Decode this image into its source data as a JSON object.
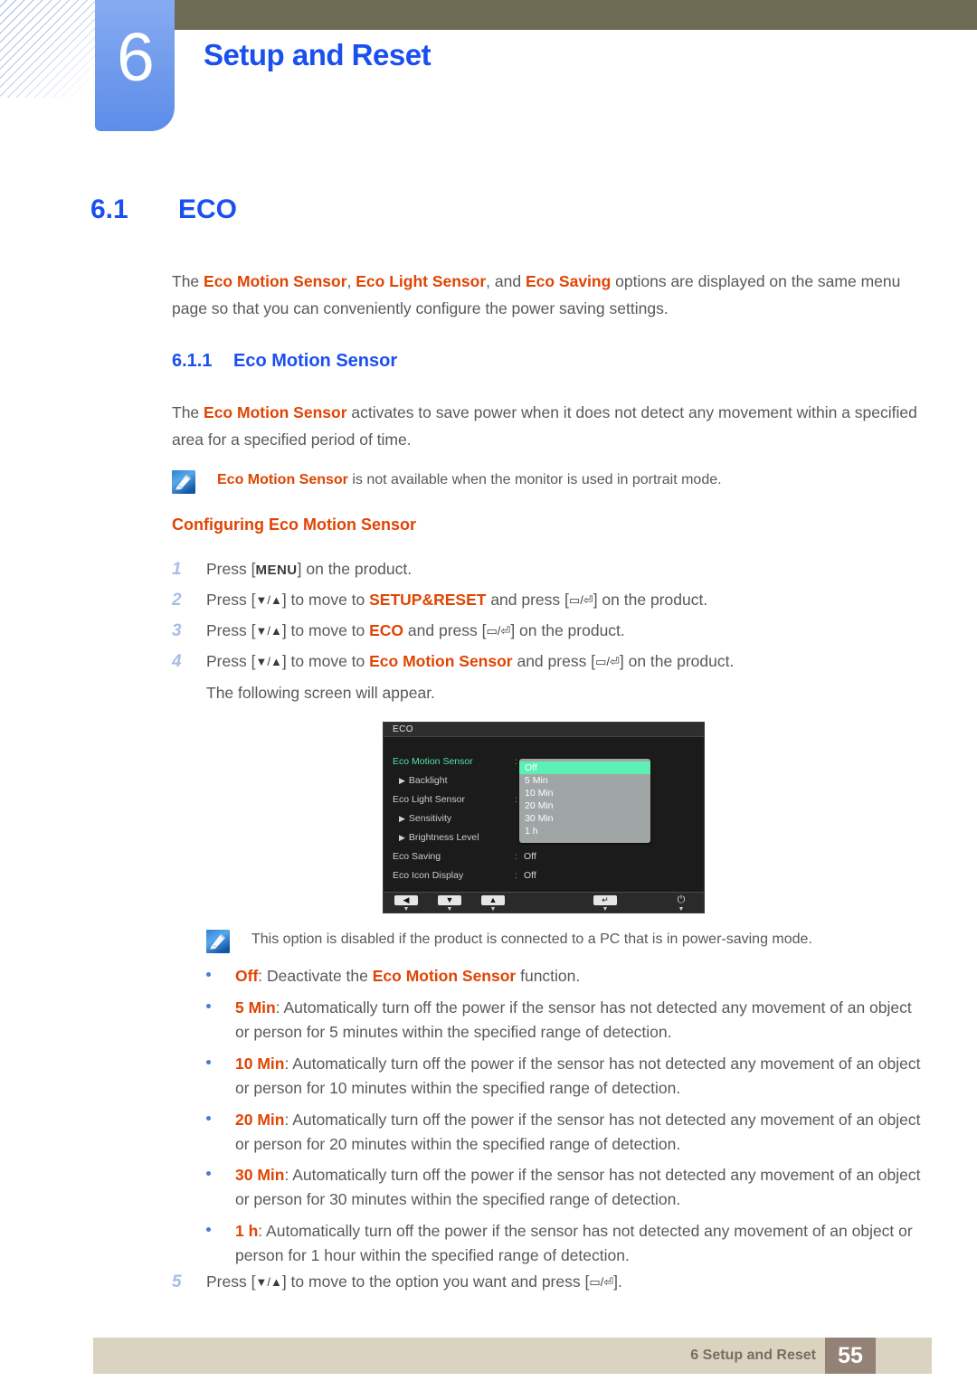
{
  "header": {
    "chapter_number": "6",
    "chapter_title": "Setup and Reset"
  },
  "section": {
    "number": "6.1",
    "title": "ECO",
    "intro": {
      "p1_a": "The ",
      "p1_k1": "Eco Motion Sensor",
      "p1_b": ", ",
      "p1_k2": "Eco Light Sensor",
      "p1_c": ", and ",
      "p1_k3": "Eco Saving",
      "p1_d": " options are displayed on the same menu page so that you can conveniently configure the power saving settings."
    }
  },
  "subsection": {
    "number": "6.1.1",
    "title": "Eco Motion Sensor",
    "paragraph": {
      "a": "The ",
      "k": "Eco Motion Sensor",
      "b": " activates to save power when it does not detect any movement within a specified area for a specified period of time."
    },
    "note1": {
      "icon": "note-pencil-icon",
      "k": "Eco Motion Sensor",
      "text": " is not available when the monitor is used in portrait mode."
    },
    "configuring_heading": "Configuring Eco Motion Sensor"
  },
  "steps": [
    {
      "num": "1",
      "parts": [
        {
          "t": "text",
          "v": "Press ["
        },
        {
          "t": "key",
          "v": "MENU"
        },
        {
          "t": "text",
          "v": "] on the product."
        }
      ]
    },
    {
      "num": "2",
      "parts": [
        {
          "t": "text",
          "v": "Press ["
        },
        {
          "t": "glyph",
          "v": "▼/▲"
        },
        {
          "t": "text",
          "v": "] to move to "
        },
        {
          "t": "kw",
          "v": "SETUP&RESET"
        },
        {
          "t": "text",
          "v": " and press ["
        },
        {
          "t": "glyph",
          "v": "▭/⏎"
        },
        {
          "t": "text",
          "v": "] on the product."
        }
      ]
    },
    {
      "num": "3",
      "parts": [
        {
          "t": "text",
          "v": "Press ["
        },
        {
          "t": "glyph",
          "v": "▼/▲"
        },
        {
          "t": "text",
          "v": "] to move to "
        },
        {
          "t": "kw",
          "v": "ECO"
        },
        {
          "t": "text",
          "v": " and press ["
        },
        {
          "t": "glyph",
          "v": "▭/⏎"
        },
        {
          "t": "text",
          "v": "] on the product."
        }
      ]
    },
    {
      "num": "4",
      "parts": [
        {
          "t": "text",
          "v": "Press ["
        },
        {
          "t": "glyph",
          "v": "▼/▲"
        },
        {
          "t": "text",
          "v": "] to move to "
        },
        {
          "t": "kw",
          "v": "Eco Motion Sensor"
        },
        {
          "t": "text",
          "v": " and press ["
        },
        {
          "t": "glyph",
          "v": "▭/⏎"
        },
        {
          "t": "text",
          "v": "] on the product."
        }
      ],
      "followup": "The following screen will appear."
    },
    {
      "num": "5",
      "parts": [
        {
          "t": "text",
          "v": "Press ["
        },
        {
          "t": "glyph",
          "v": "▼/▲"
        },
        {
          "t": "text",
          "v": "] to move to the option you want and press ["
        },
        {
          "t": "glyph",
          "v": "▭/⏎"
        },
        {
          "t": "text",
          "v": "]."
        }
      ]
    }
  ],
  "osd": {
    "title": "ECO",
    "rows": [
      {
        "label": "Eco Motion Sensor",
        "colon": ":",
        "value": "",
        "selected": true,
        "sub": false
      },
      {
        "label": "Backlight",
        "colon": "",
        "value": "",
        "selected": false,
        "sub": true
      },
      {
        "label": "Eco Light Sensor",
        "colon": ":",
        "value": "",
        "selected": false,
        "sub": false
      },
      {
        "label": "Sensitivity",
        "colon": ":",
        "value": "",
        "selected": false,
        "sub": true
      },
      {
        "label": "Brightness Level",
        "colon": "",
        "value": "",
        "selected": false,
        "sub": true
      },
      {
        "label": "Eco Saving",
        "colon": ":",
        "value": "Off",
        "selected": false,
        "sub": false
      },
      {
        "label": "Eco Icon Display",
        "colon": ":",
        "value": "Off",
        "selected": false,
        "sub": false
      }
    ],
    "dropdown": {
      "options": [
        "Off",
        "5 Min",
        "10 Min",
        "20 Min",
        "30 Min",
        "1 h"
      ],
      "selected": "Off"
    },
    "buttons": [
      {
        "name": "left-arrow",
        "glyph": "◀"
      },
      {
        "name": "down-arrow",
        "glyph": "▼"
      },
      {
        "name": "up-arrow",
        "glyph": "▲"
      },
      {
        "name": "enter",
        "glyph": "↵"
      },
      {
        "name": "power",
        "glyph": "⏻"
      }
    ],
    "colors": {
      "highlight": "#5df0b4",
      "selected_label": "#4ee2a3",
      "background": "#1b1b1b",
      "dropdown_bg": "#9fa6a5"
    }
  },
  "note2": {
    "icon": "note-pencil-icon",
    "text": "This option is disabled if the product is connected to a PC that is in power-saving mode."
  },
  "bullets": [
    {
      "term": "Off",
      "body_a": ": Deactivate the ",
      "body_k": "Eco Motion Sensor",
      "body_b": " function."
    },
    {
      "term": "5 Min",
      "body_a": ": Automatically turn off the power if the sensor has not detected any movement of an object or person for 5 minutes within the specified range of detection.",
      "body_k": "",
      "body_b": ""
    },
    {
      "term": "10 Min",
      "body_a": ": Automatically turn off the power if the sensor has not detected any movement of an object or person for 10 minutes within the specified range of detection.",
      "body_k": "",
      "body_b": ""
    },
    {
      "term": "20 Min",
      "body_a": ": Automatically turn off the power if the sensor has not detected any movement of an object or person for 20 minutes within the specified range of detection.",
      "body_k": "",
      "body_b": ""
    },
    {
      "term": "30 Min",
      "body_a": ": Automatically turn off the power if the sensor has not detected any movement of an object or person for 30 minutes within the specified range of detection.",
      "body_k": "",
      "body_b": ""
    },
    {
      "term": "1 h",
      "body_a": ": Automatically turn off the power if the sensor has not detected any movement of an object or person for 1 hour within the specified range of detection.",
      "body_k": "",
      "body_b": ""
    }
  ],
  "footer": {
    "text": "6 Setup and Reset",
    "page": "55"
  },
  "colors": {
    "heading_blue": "#1a4ff0",
    "keyword_orange": "#e04403",
    "olive_bar": "#6e6b55",
    "tab_blue": "#6d99ec",
    "footer_bar": "#d9d3c0",
    "footer_page_box": "#938275"
  }
}
